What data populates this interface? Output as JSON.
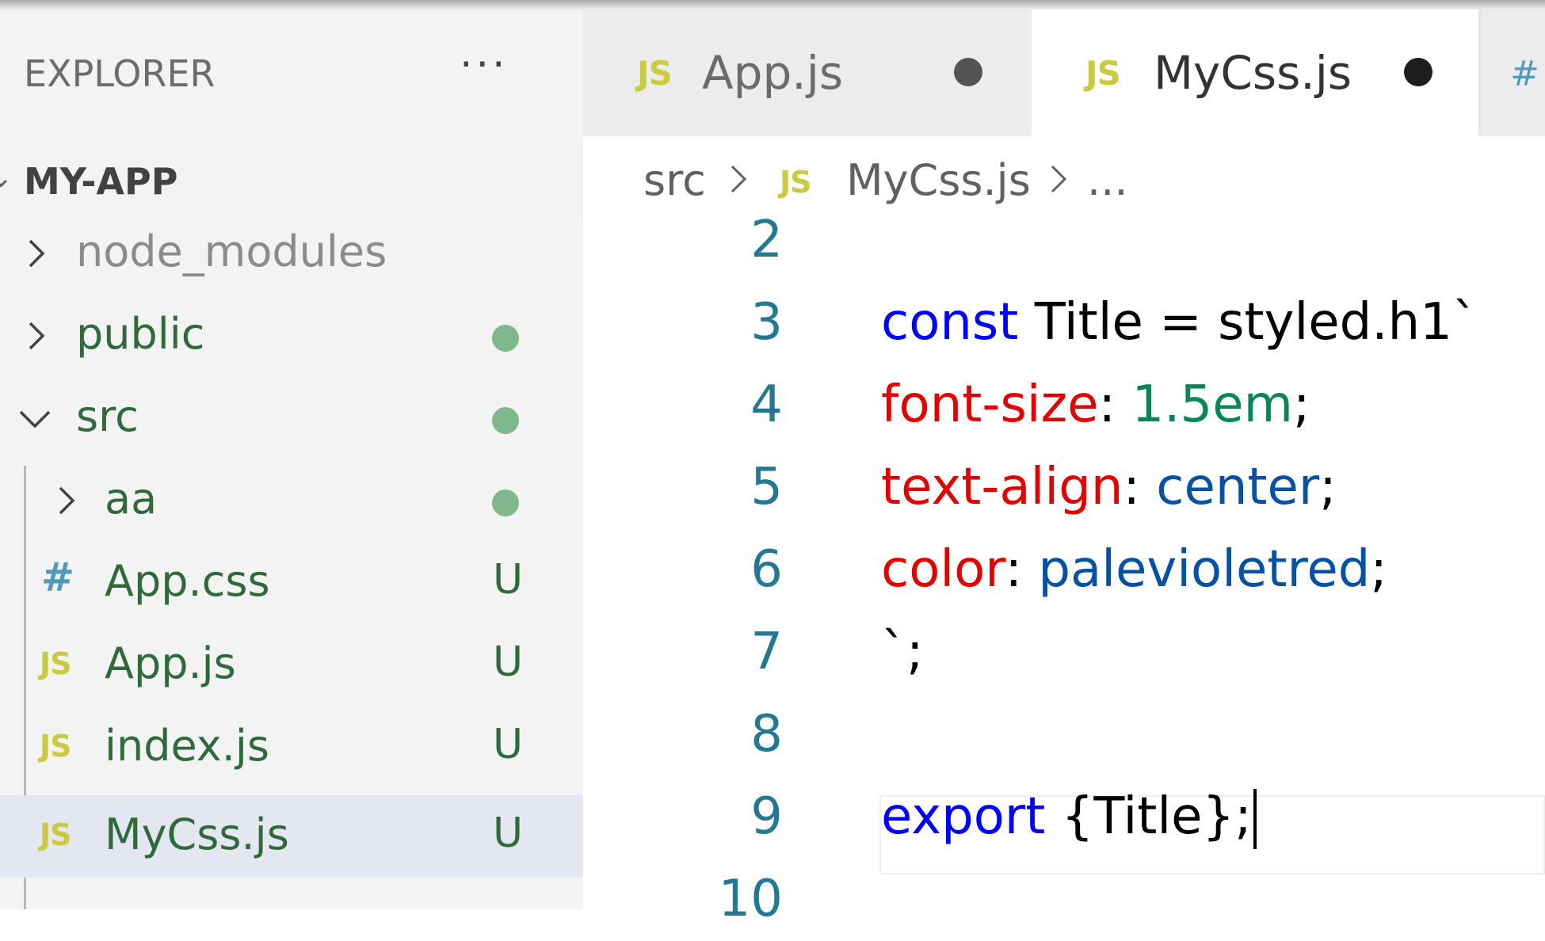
{
  "sidebar": {
    "title": "EXPLORER",
    "more": "···",
    "project": "MY-APP",
    "items": [
      {
        "label": "node_modules",
        "icon": "chevron-right",
        "status": ""
      },
      {
        "label": "public",
        "icon": "chevron-right",
        "status": "dot"
      },
      {
        "label": "src",
        "icon": "chevron-down",
        "status": "dot"
      },
      {
        "label": "aa",
        "icon": "chevron-right",
        "status": "dot"
      },
      {
        "label": "App.css",
        "icon": "#",
        "status": "U"
      },
      {
        "label": "App.js",
        "icon": "JS",
        "status": "U"
      },
      {
        "label": "index.js",
        "icon": "JS",
        "status": "U"
      },
      {
        "label": "MyCss.js",
        "icon": "JS",
        "status": "U",
        "selected": true
      }
    ]
  },
  "tabs": [
    {
      "icon": "JS",
      "label": "App.js",
      "modified": true,
      "active": false
    },
    {
      "icon": "JS",
      "label": "MyCss.js",
      "modified": true,
      "active": true
    }
  ],
  "breadcrumb": {
    "folder": "src",
    "file_icon": "JS",
    "file": "MyCss.js",
    "more": "..."
  },
  "editor": {
    "lines": [
      {
        "n": "2"
      },
      {
        "n": "3",
        "tokens": [
          "const",
          " Title = styled.h1`"
        ]
      },
      {
        "n": "4",
        "tokens": [
          "font-size",
          ": ",
          "1.5em",
          ";"
        ]
      },
      {
        "n": "5",
        "tokens": [
          "text-align",
          ": ",
          "center",
          ";"
        ]
      },
      {
        "n": "6",
        "tokens": [
          "color",
          ": ",
          "palevioletred",
          ";"
        ]
      },
      {
        "n": "7",
        "tokens": [
          "`;"
        ]
      },
      {
        "n": "8"
      },
      {
        "n": "9",
        "tokens": [
          "export",
          " {Title};"
        ]
      },
      {
        "n": "10"
      }
    ]
  },
  "colors": {
    "keyword": "#0000ff",
    "property": "#e50000",
    "number": "#098658",
    "value": "#0451a5",
    "line_number": "#237893",
    "git_untracked": "#2f6b3a",
    "git_dot": "#81b88b",
    "js_icon": "#cbcb41",
    "css_icon": "#519aba"
  }
}
